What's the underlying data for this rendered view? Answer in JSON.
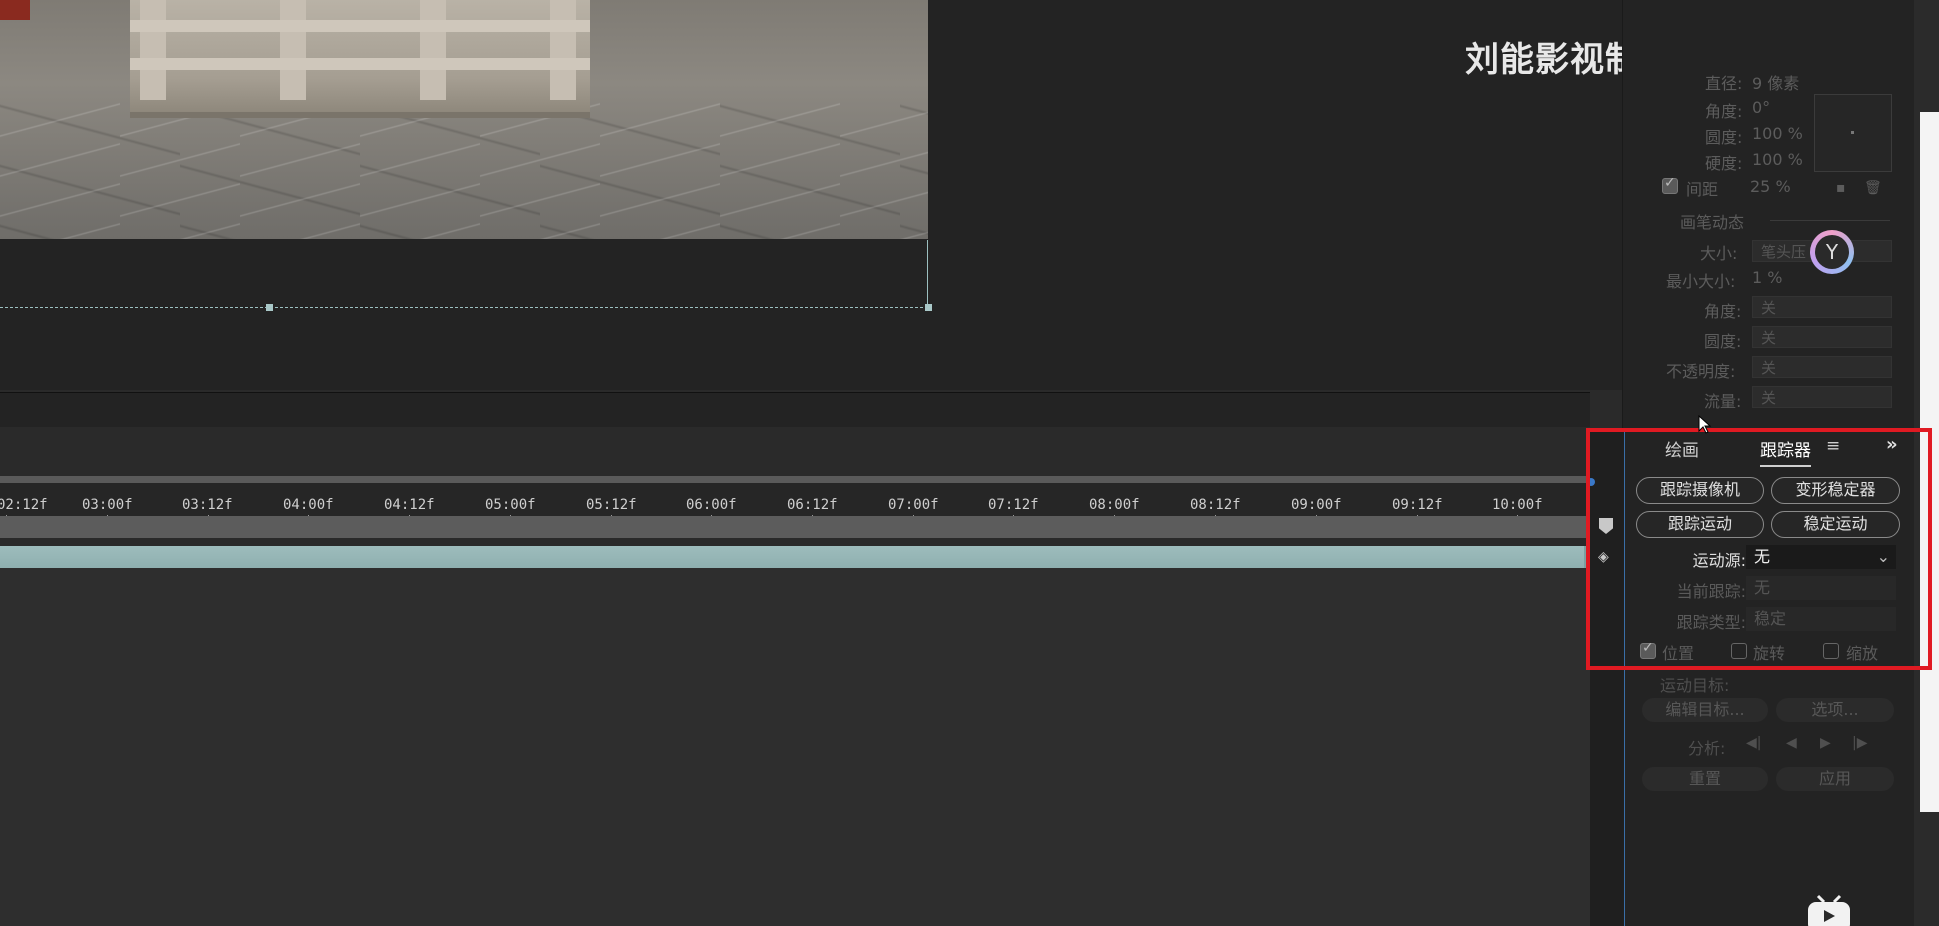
{
  "watermark": {
    "text": "刘能影视制片厂",
    "logo": "bilibili"
  },
  "brush_panel": {
    "diameter_label": "直径:",
    "diameter_value": "9 像素",
    "angle_label": "角度:",
    "angle_value": "0°",
    "roundness_label": "圆度:",
    "roundness_value": "100 %",
    "hardness_label": "硬度:",
    "hardness_value": "100 %",
    "spacing_label": "间距",
    "spacing_value": "25 %",
    "dynamics_title": "画笔动态",
    "size_label": "大小:",
    "size_value": "笔头压",
    "min_size_label": "最小大小:",
    "min_size_value": "1 %",
    "angle2_label": "角度:",
    "angle2_value": "关",
    "roundness2_label": "圆度:",
    "roundness2_value": "关",
    "opacity_label": "不透明度:",
    "opacity_value": "关",
    "flow_label": "流量:",
    "flow_value": "关"
  },
  "timeline": {
    "ticks": [
      "02:12f",
      "03:00f",
      "03:12f",
      "04:00f",
      "04:12f",
      "05:00f",
      "05:12f",
      "06:00f",
      "06:12f",
      "07:00f",
      "07:12f",
      "08:00f",
      "08:12f",
      "09:00f",
      "09:12f",
      "10:00f"
    ]
  },
  "tracker": {
    "tab_paint": "绘画",
    "tab_tracker": "跟踪器",
    "btn_track_camera": "跟踪摄像机",
    "btn_warp_stabilizer": "变形稳定器",
    "btn_track_motion": "跟踪运动",
    "btn_stabilize_motion": "稳定运动",
    "motion_source_label": "运动源:",
    "motion_source_value": "无",
    "current_track_label": "当前跟踪:",
    "current_track_value": "无",
    "track_type_label": "跟踪类型:",
    "track_type_value": "稳定",
    "chk_position": "位置",
    "chk_rotation": "旋转",
    "chk_scale": "缩放",
    "motion_target_label": "运动目标:",
    "btn_edit_target": "编辑目标...",
    "btn_options": "选项...",
    "analyze_label": "分析:",
    "btn_reset": "重置",
    "btn_apply": "应用"
  },
  "colors": {
    "highlight": "#e01a22",
    "layer_bar": "#9dbcbc",
    "accent_border": "#3a6fa8"
  }
}
